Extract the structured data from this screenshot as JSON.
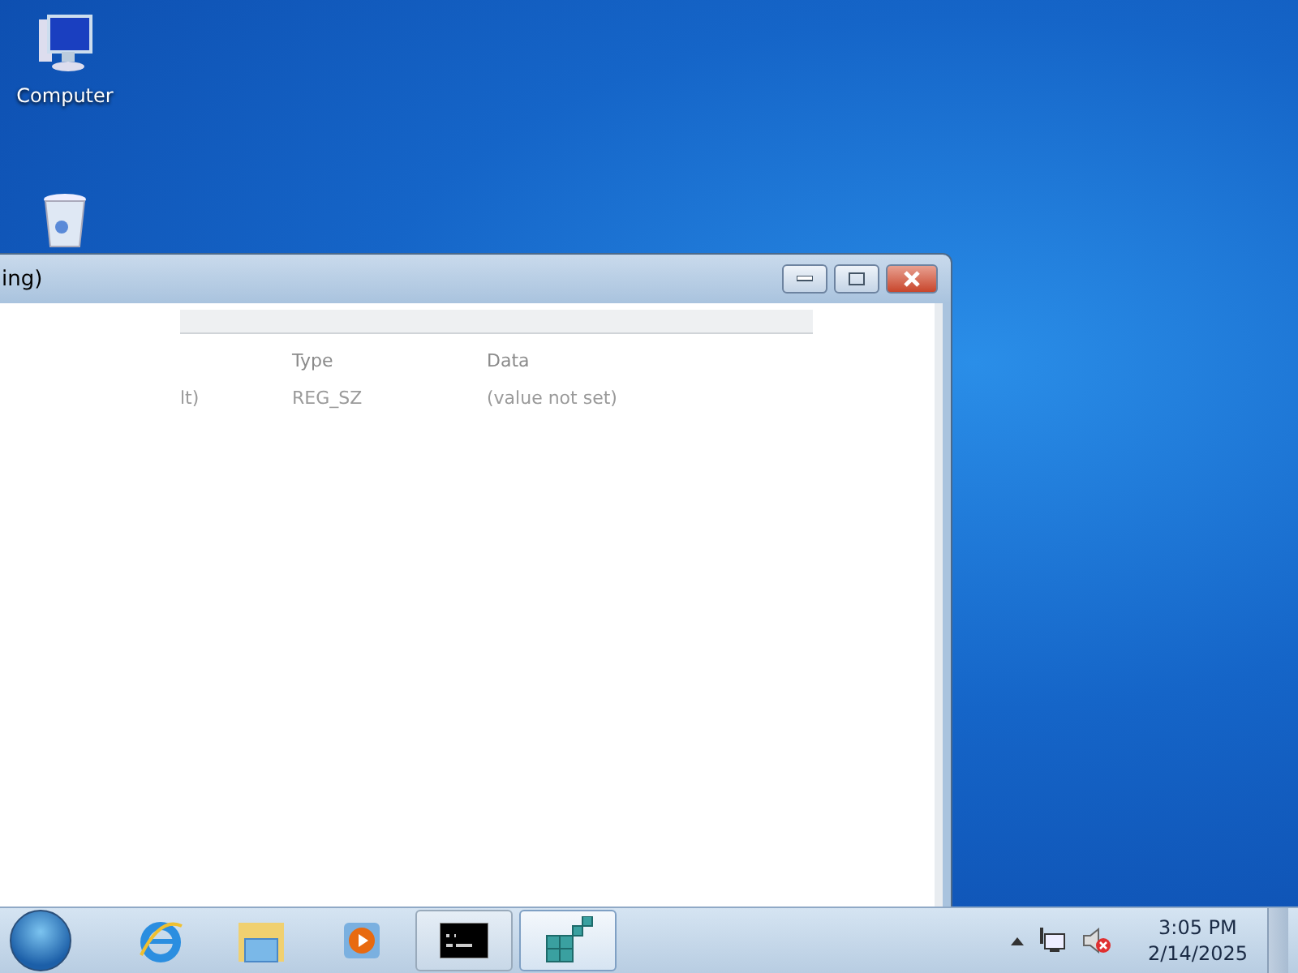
{
  "desktop_icons": [
    {
      "kind": "computer",
      "label": "Computer"
    },
    {
      "kind": "recycle-bin"
    }
  ],
  "window": {
    "title": "ing)",
    "columns": [
      "Type",
      "Data"
    ],
    "rows": [
      {
        "name": "lt)",
        "type": "REG_SZ",
        "data": "(value not set)"
      }
    ]
  },
  "taskbar": {
    "pinned": [
      {
        "kind": "browser"
      },
      {
        "kind": "folder"
      },
      {
        "kind": "media"
      }
    ],
    "open_apps": [
      {
        "kind": "console",
        "selected": false
      },
      {
        "kind": "registry",
        "selected": true
      }
    ],
    "clock": {
      "time": "3:05 PM",
      "date": "2/14/2025"
    }
  }
}
